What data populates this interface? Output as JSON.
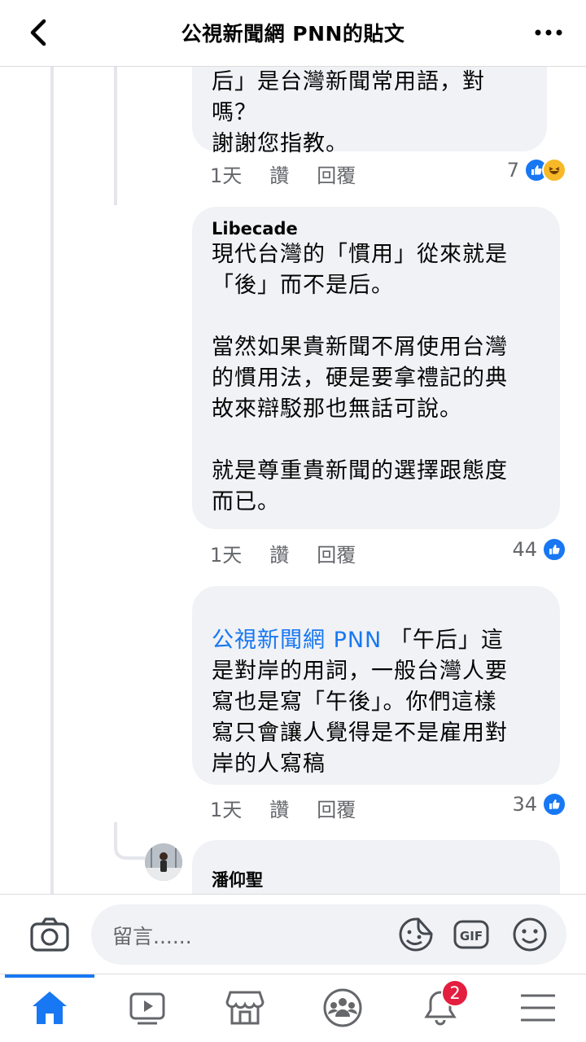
{
  "header": {
    "title": "公視新聞網 PNN的貼文"
  },
  "comments": [
    {
      "text": "后」是台灣新聞常用語，對\n嗎？\n謝謝您指教。",
      "time": "1天",
      "like_label": "讚",
      "reply_label": "回覆",
      "reaction_count": "7"
    },
    {
      "author": "Libecade",
      "text": "現代台灣的「慣用」從來就是\n「後」而不是后。\n\n當然如果貴新聞不屑使用台灣\n的慣用法，硬是要拿禮記的典\n故來辯駁那也無話可說。\n\n就是尊重貴新聞的選擇跟態度\n而已。",
      "time": "1天",
      "like_label": "讚",
      "reply_label": "回覆",
      "reaction_count": "44"
    },
    {
      "mention": "公視新聞網 PNN",
      "text": "「午后」這\n是對岸的用詞，一般台灣人要\n寫也是寫「午後」。你們這樣\n寫只會讓人覺得是不是雇用對\n岸的人寫稿",
      "time": "1天",
      "like_label": "讚",
      "reply_label": "回覆",
      "reaction_count": "34"
    },
    {
      "author": "潘仰聖"
    }
  ],
  "composer": {
    "placeholder": "留言......"
  },
  "tabs": {
    "notification_badge": "2"
  },
  "colors": {
    "accent": "#1877f2",
    "bubble": "#f0f2f5",
    "badge": "#e41e3f"
  },
  "icons": [
    "back-arrow-icon",
    "more-dots-icon",
    "camera-icon",
    "sticker-icon",
    "gif-icon",
    "emoji-icon",
    "home-icon",
    "video-icon",
    "marketplace-icon",
    "groups-icon",
    "bell-icon",
    "menu-icon"
  ]
}
